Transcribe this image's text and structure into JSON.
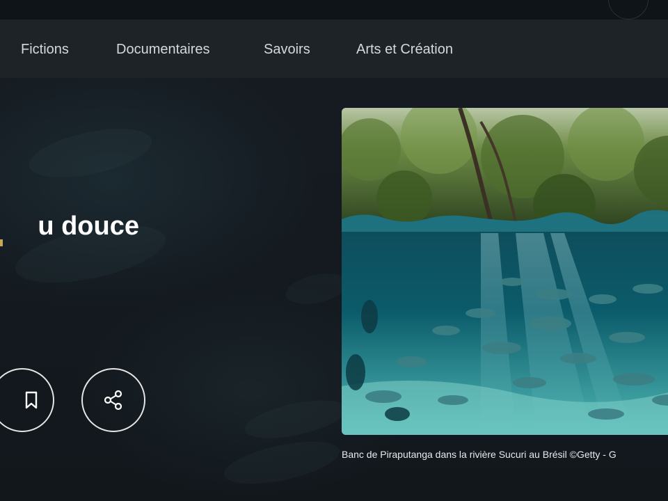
{
  "nav": {
    "items": [
      {
        "label": "Fictions"
      },
      {
        "label": "Documentaires"
      },
      {
        "label": "Savoirs"
      },
      {
        "label": "Arts et Création"
      }
    ]
  },
  "hero": {
    "title_visible": "u douce"
  },
  "actions": {
    "bookmark_icon": "bookmark-icon",
    "share_icon": "share-icon"
  },
  "image": {
    "caption": "Banc de Piraputanga dans la rivière Sucuri au Brésil ©Getty - G"
  },
  "colors": {
    "background": "#141a20",
    "navbar": "#1e2328",
    "nav_text": "#d6d9dc",
    "accent": "#c6a65a"
  }
}
